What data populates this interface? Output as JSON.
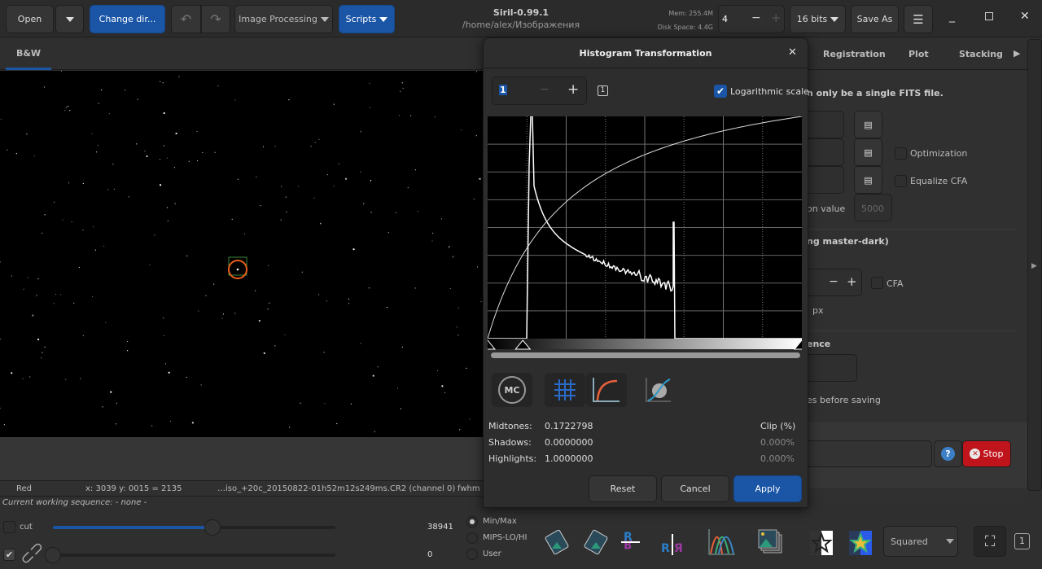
{
  "header": {
    "open": "Open",
    "change_dir": "Change dir...",
    "image_processing": "Image Processing",
    "scripts": "Scripts",
    "app_title": "Siril-0.99.1",
    "path": "/home/alex/Изображения",
    "mem": "Mem: 255.4M",
    "disk": "Disk Space: 4.4G",
    "thread_value": "4",
    "bits": "16 bits",
    "save_as": "Save As"
  },
  "tabs": {
    "left": "B&W",
    "right": [
      "Registration",
      "Plot",
      "Stacking"
    ]
  },
  "right_panel": {
    "notice": "n only be a single FITS file.",
    "optimization": "Optimization",
    "equalize_cfa": "Equalize CFA",
    "norm_label": "on value",
    "norm_placeholder": "5000",
    "section2": "ng master-dark)",
    "cfa": "CFA",
    "px": "px",
    "section3": "ence",
    "save_note": "es before saving",
    "stop": "Stop"
  },
  "status": {
    "channel": "Red",
    "coords": "x: 3039 y: 0015 = 2135",
    "file": "…iso_+20c_20150822-01h52m12s249ms.CR2 (channel 0)",
    "fwhm": "fwhm"
  },
  "sequence": "Current working sequence: - none -",
  "bottom": {
    "cut": "cut",
    "high_value": "38941",
    "low_value": "0",
    "high_fraction": 0.565,
    "low_fraction": 0.0,
    "modes": [
      "Min/Max",
      "MIPS-LO/HI",
      "User"
    ],
    "selected_mode": "Min/Max",
    "display_mode": "Squared",
    "zoom_badge": "1"
  },
  "dialog": {
    "title": "Histogram Transformation",
    "zoom_value": "1",
    "log_scale": "Logarithmic scale",
    "log_checked": true,
    "midtones_label": "Midtones:",
    "midtones": "0.1722798",
    "shadows_label": "Shadows:",
    "shadows": "0.0000000",
    "highlights_label": "Highlights:",
    "highlights": "1.0000000",
    "clip_label": "Clip (%)",
    "clip_shadows": "0.000%",
    "clip_highlights": "0.000%",
    "reset": "Reset",
    "cancel": "Cancel",
    "apply": "Apply",
    "mc": "MC",
    "badge": "1"
  },
  "colors": {
    "accent": "#1a55a6",
    "stop": "#c0141c"
  }
}
